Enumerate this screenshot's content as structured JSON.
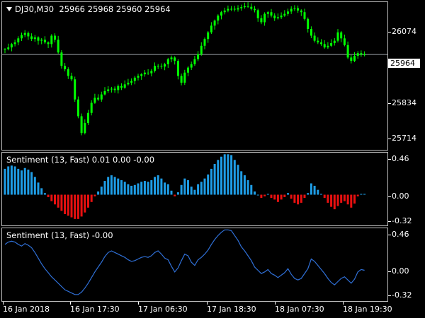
{
  "chart_data": [
    {
      "type": "candlestick",
      "title": "DJ30,M30  25966 25968 25960 25964",
      "symbol": "DJ30,M30",
      "ohlc_readout": [
        "25966",
        "25968",
        "25960",
        "25964"
      ],
      "current_price": "25964",
      "ylim": [
        25680,
        26120
      ],
      "yticks": [
        "26074",
        "25964",
        "25834",
        "25714"
      ],
      "close": [
        25980,
        25985,
        25995,
        26000,
        26012,
        26022,
        26028,
        26018,
        26010,
        26015,
        26005,
        26008,
        26000,
        25995,
        26020,
        26008,
        25970,
        25930,
        25920,
        25900,
        25890,
        25830,
        25780,
        25730,
        25760,
        25790,
        25820,
        25835,
        25830,
        25845,
        25855,
        25860,
        25862,
        25858,
        25870,
        25865,
        25875,
        25880,
        25885,
        25895,
        25900,
        25905,
        25910,
        25908,
        25915,
        25930,
        25930,
        25928,
        25935,
        25950,
        25955,
        25945,
        25900,
        25880,
        25910,
        25925,
        25935,
        25950,
        25965,
        25990,
        26010,
        26030,
        26050,
        26065,
        26080,
        26090,
        26095,
        26100,
        26100,
        26098,
        26102,
        26105,
        26108,
        26106,
        26100,
        26096,
        26072,
        26060,
        26085,
        26090,
        26080,
        26072,
        26075,
        26080,
        26085,
        26092,
        26100,
        26102,
        26095,
        26090,
        26070,
        26040,
        26020,
        26005,
        26000,
        25995,
        25985,
        25990,
        25998,
        26005,
        26030,
        26012,
        25992,
        25955,
        25945,
        25960,
        25968,
        25964,
        25964
      ],
      "color": "#00ff00"
    },
    {
      "type": "bar",
      "title": "Sentiment (13, Fast) 0.01 0.00 -0.00",
      "ylim": [
        -0.38,
        0.52
      ],
      "yticks": [
        "0.46",
        "0.00",
        "-0.32"
      ],
      "values": [
        0.32,
        0.35,
        0.36,
        0.35,
        0.32,
        0.3,
        0.33,
        0.31,
        0.28,
        0.22,
        0.15,
        0.08,
        0.02,
        -0.03,
        -0.08,
        -0.12,
        -0.16,
        -0.2,
        -0.24,
        -0.26,
        -0.28,
        -0.3,
        -0.3,
        -0.27,
        -0.22,
        -0.16,
        -0.09,
        -0.02,
        0.04,
        0.1,
        0.17,
        0.22,
        0.24,
        0.22,
        0.2,
        0.18,
        0.16,
        0.13,
        0.11,
        0.12,
        0.14,
        0.16,
        0.17,
        0.16,
        0.18,
        0.22,
        0.24,
        0.2,
        0.15,
        0.13,
        0.05,
        -0.02,
        0.03,
        0.12,
        0.2,
        0.18,
        0.1,
        0.06,
        0.13,
        0.16,
        0.2,
        0.25,
        0.32,
        0.38,
        0.43,
        0.47,
        0.5,
        0.5,
        0.49,
        0.43,
        0.37,
        0.29,
        0.24,
        0.18,
        0.12,
        0.04,
        0.0,
        -0.04,
        -0.02,
        0.01,
        -0.04,
        -0.06,
        -0.09,
        -0.06,
        -0.03,
        0.02,
        -0.05,
        -0.1,
        -0.12,
        -0.1,
        -0.04,
        0.02,
        0.14,
        0.11,
        0.06,
        0.01,
        -0.04,
        -0.1,
        -0.15,
        -0.18,
        -0.14,
        -0.1,
        -0.08,
        -0.12,
        -0.16,
        -0.11,
        -0.02,
        0.01,
        0.01
      ],
      "positive_color": "#1e9de6",
      "negative_color": "#e81010"
    },
    {
      "type": "line",
      "title": "Sentiment (13, Fast) -0.00",
      "ylim": [
        -0.38,
        0.52
      ],
      "yticks": [
        "0.46",
        "0.00",
        "-0.32"
      ],
      "values": [
        0.32,
        0.35,
        0.36,
        0.35,
        0.32,
        0.3,
        0.33,
        0.31,
        0.28,
        0.22,
        0.15,
        0.08,
        0.02,
        -0.03,
        -0.08,
        -0.12,
        -0.16,
        -0.2,
        -0.24,
        -0.26,
        -0.28,
        -0.3,
        -0.3,
        -0.27,
        -0.22,
        -0.16,
        -0.09,
        -0.02,
        0.04,
        0.1,
        0.17,
        0.22,
        0.24,
        0.22,
        0.2,
        0.18,
        0.16,
        0.13,
        0.11,
        0.12,
        0.14,
        0.16,
        0.17,
        0.16,
        0.18,
        0.22,
        0.24,
        0.2,
        0.15,
        0.13,
        0.05,
        -0.02,
        0.03,
        0.12,
        0.2,
        0.18,
        0.1,
        0.06,
        0.13,
        0.16,
        0.2,
        0.25,
        0.32,
        0.38,
        0.43,
        0.47,
        0.5,
        0.5,
        0.49,
        0.43,
        0.37,
        0.29,
        0.24,
        0.18,
        0.12,
        0.04,
        0.0,
        -0.04,
        -0.02,
        0.01,
        -0.04,
        -0.06,
        -0.09,
        -0.06,
        -0.03,
        0.02,
        -0.05,
        -0.1,
        -0.12,
        -0.1,
        -0.04,
        0.02,
        0.14,
        0.11,
        0.06,
        0.01,
        -0.04,
        -0.1,
        -0.15,
        -0.18,
        -0.14,
        -0.1,
        -0.08,
        -0.12,
        -0.16,
        -0.11,
        -0.02,
        0.01,
        0.0
      ],
      "color": "#2f6fd6"
    }
  ],
  "time_axis": [
    "16 Jan 2018",
    "16 Jan 17:30",
    "17 Jan 06:30",
    "17 Jan 18:30",
    "18 Jan 07:30",
    "18 Jan 19:30"
  ]
}
